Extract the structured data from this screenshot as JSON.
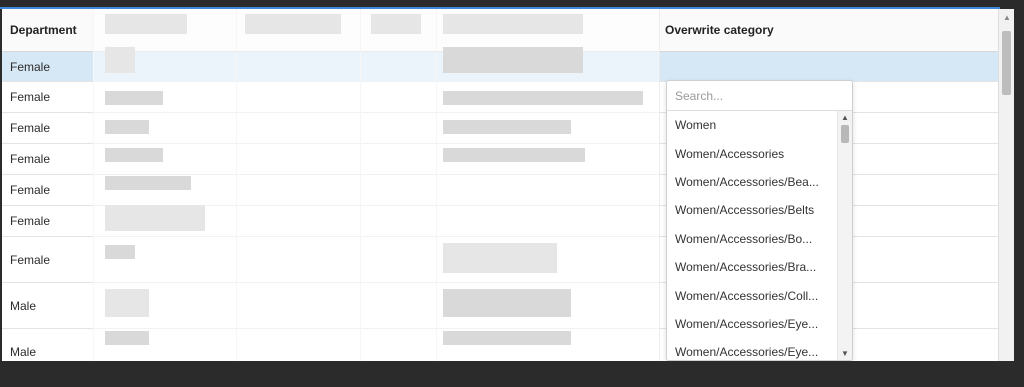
{
  "grid": {
    "headers": {
      "department": "Department",
      "overwrite": "Overwrite category"
    },
    "rows": [
      {
        "department": "Female"
      },
      {
        "department": "Female"
      },
      {
        "department": "Female"
      },
      {
        "department": "Female"
      },
      {
        "department": "Female"
      },
      {
        "department": "Female"
      },
      {
        "department": "Female"
      },
      {
        "department": "Male"
      },
      {
        "department": "Male"
      }
    ]
  },
  "dropdown": {
    "placeholder": "Search...",
    "options": [
      "Women",
      "Women/Accessories",
      "Women/Accessories/Bea...",
      "Women/Accessories/Belts",
      "Women/Accessories/Bo...",
      "Women/Accessories/Bra...",
      "Women/Accessories/Coll...",
      "Women/Accessories/Eye...",
      "Women/Accessories/Eye..."
    ]
  },
  "colors": {
    "accent": "#3f87d9",
    "selected_row": "#d6e7f6"
  },
  "icons": {
    "scroll_up": "triangle-up-icon",
    "scroll_down": "triangle-down-icon"
  }
}
